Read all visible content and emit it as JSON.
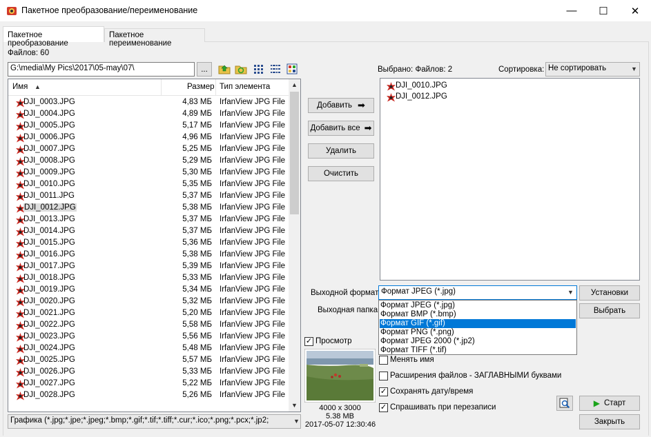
{
  "window": {
    "title": "Пакетное преобразование/переименование",
    "minimize": "—",
    "maximize": "☐",
    "close": "✕"
  },
  "tabs": [
    {
      "label": "Пакетное преобразование",
      "active": true
    },
    {
      "label": "Пакетное переименование",
      "active": false
    }
  ],
  "left": {
    "files_count_label": "Файлов: 60",
    "path": "G:\\media\\My Pics\\2017\\05-may\\07\\",
    "browse_label": "...",
    "columns": {
      "name": "Имя",
      "size": "Размер",
      "type": "Тип элемента"
    },
    "files": [
      {
        "name": "DJI_0003.JPG",
        "size": "4,83 МБ",
        "type": "IrfanView JPG File"
      },
      {
        "name": "DJI_0004.JPG",
        "size": "4,89 МБ",
        "type": "IrfanView JPG File"
      },
      {
        "name": "DJI_0005.JPG",
        "size": "5,17 МБ",
        "type": "IrfanView JPG File"
      },
      {
        "name": "DJI_0006.JPG",
        "size": "4,96 МБ",
        "type": "IrfanView JPG File"
      },
      {
        "name": "DJI_0007.JPG",
        "size": "5,25 МБ",
        "type": "IrfanView JPG File"
      },
      {
        "name": "DJI_0008.JPG",
        "size": "5,29 МБ",
        "type": "IrfanView JPG File"
      },
      {
        "name": "DJI_0009.JPG",
        "size": "5,30 МБ",
        "type": "IrfanView JPG File"
      },
      {
        "name": "DJI_0010.JPG",
        "size": "5,35 МБ",
        "type": "IrfanView JPG File"
      },
      {
        "name": "DJI_0011.JPG",
        "size": "5,37 МБ",
        "type": "IrfanView JPG File"
      },
      {
        "name": "DJI_0012.JPG",
        "size": "5,38 МБ",
        "type": "IrfanView JPG File"
      },
      {
        "name": "DJI_0013.JPG",
        "size": "5,37 МБ",
        "type": "IrfanView JPG File"
      },
      {
        "name": "DJI_0014.JPG",
        "size": "5,37 МБ",
        "type": "IrfanView JPG File"
      },
      {
        "name": "DJI_0015.JPG",
        "size": "5,36 МБ",
        "type": "IrfanView JPG File"
      },
      {
        "name": "DJI_0016.JPG",
        "size": "5,38 МБ",
        "type": "IrfanView JPG File"
      },
      {
        "name": "DJI_0017.JPG",
        "size": "5,39 МБ",
        "type": "IrfanView JPG File"
      },
      {
        "name": "DJI_0018.JPG",
        "size": "5,33 МБ",
        "type": "IrfanView JPG File"
      },
      {
        "name": "DJI_0019.JPG",
        "size": "5,34 МБ",
        "type": "IrfanView JPG File"
      },
      {
        "name": "DJI_0020.JPG",
        "size": "5,32 МБ",
        "type": "IrfanView JPG File"
      },
      {
        "name": "DJI_0021.JPG",
        "size": "5,20 МБ",
        "type": "IrfanView JPG File"
      },
      {
        "name": "DJI_0022.JPG",
        "size": "5,58 МБ",
        "type": "IrfanView JPG File"
      },
      {
        "name": "DJI_0023.JPG",
        "size": "5,56 МБ",
        "type": "IrfanView JPG File"
      },
      {
        "name": "DJI_0024.JPG",
        "size": "5,48 МБ",
        "type": "IrfanView JPG File"
      },
      {
        "name": "DJI_0025.JPG",
        "size": "5,57 МБ",
        "type": "IrfanView JPG File"
      },
      {
        "name": "DJI_0026.JPG",
        "size": "5,33 МБ",
        "type": "IrfanView JPG File"
      },
      {
        "name": "DJI_0027.JPG",
        "size": "5,22 МБ",
        "type": "IrfanView JPG File"
      },
      {
        "name": "DJI_0028.JPG",
        "size": "5,26 МБ",
        "type": "IrfanView JPG File"
      }
    ],
    "selected_row": "DJI_0012.JPG",
    "filter": "Графика (*.jpg;*.jpe;*.jpeg;*.bmp;*.gif;*.tif;*.tiff;*.cur;*.ico;*.png;*.pcx;*.jp2;"
  },
  "middle": {
    "add": "Добавить",
    "add_all": "Добавить все",
    "remove": "Удалить",
    "clear": "Очистить"
  },
  "right": {
    "selected_label": "Выбрано:  Файлов: 2",
    "sort_label": "Сортировка:",
    "sort_value": "Не сортировать",
    "selected_files": [
      "DJI_0010.JPG",
      "DJI_0012.JPG"
    ],
    "output_format_label": "Выходной формат:",
    "output_format_value": "Формат JPEG (*.jpg)",
    "settings_button": "Установки",
    "output_folder_label": "Выходная папка:",
    "choose_button": "Выбрать",
    "format_options": [
      "Формат JPEG (*.jpg)",
      "Формат BMP (*.bmp)",
      "Формат GIF (*.gif)",
      "Формат PNG (*.png)",
      "Формат JPEG 2000 (*.jp2)",
      "Формат TIFF (*.tif)"
    ],
    "highlighted_option": "Формат GIF (*.gif)",
    "options": {
      "rename": "Менять имя",
      "uppercase_ext": "Расширения файлов - ЗАГЛАВНЫМИ буквами",
      "keep_date": "Сохранять дату/время",
      "ask_overwrite": "Спрашивать при перезаписи"
    },
    "checks": {
      "rename": false,
      "uppercase_ext": false,
      "keep_date": true,
      "ask_overwrite": true
    },
    "start_button": "Старт",
    "close_button": "Закрыть"
  },
  "preview": {
    "label": "Просмотр",
    "checked": true,
    "dimensions": "4000 x 3000",
    "filesize": "5.38 MB",
    "datetime": "2017-05-07 12:30:46"
  },
  "colors": {
    "accent": "#0078d7",
    "start_green": "#1aa31a"
  }
}
